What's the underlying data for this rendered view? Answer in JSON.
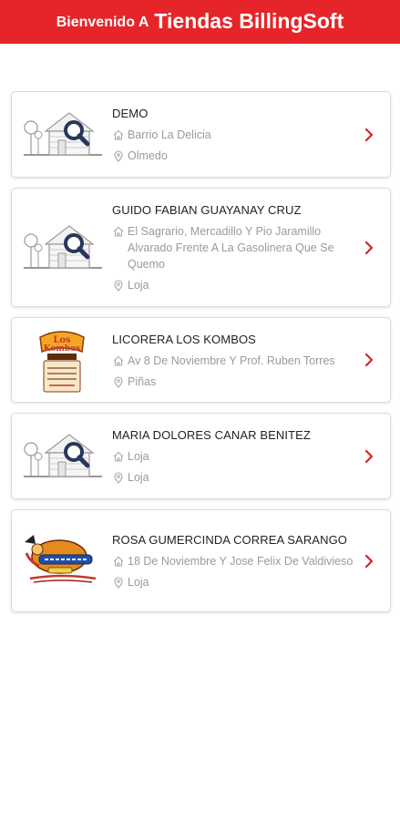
{
  "header": {
    "welcome": "Bienvenido A",
    "brand": "Tiendas BillingSoft"
  },
  "colors": {
    "accent": "#e5252a",
    "text_muted": "#9a9a9a",
    "chevron": "#d6232a"
  },
  "stores": [
    {
      "name": "DEMO",
      "address": "Barrio La Delicia",
      "city": "Olmedo",
      "image": "placeholder-house-icon"
    },
    {
      "name": "GUIDO FABIAN GUAYANAY CRUZ",
      "address": "El Sagrario, Mercadillo Y Pio Jaramillo Alvarado Frente A La Gasolinera Que Se Quemo",
      "city": "Loja",
      "image": "placeholder-house-icon"
    },
    {
      "name": "LICORERA LOS KOMBOS",
      "address": "Av 8 De Noviembre Y Prof. Ruben Torres",
      "city": "Piñas",
      "image": "los-kombos-logo",
      "logo_text": "Los Kombos"
    },
    {
      "name": "MARIA DOLORES CANAR BENITEZ",
      "address": "Loja",
      "city": "Loja",
      "image": "placeholder-house-icon"
    },
    {
      "name": "ROSA GUMERCINDA CORREA SARANGO",
      "address": "18 De Noviembre Y Jose Felix De Valdivieso",
      "city": "Loja",
      "image": "store-cartoon-logo"
    }
  ]
}
